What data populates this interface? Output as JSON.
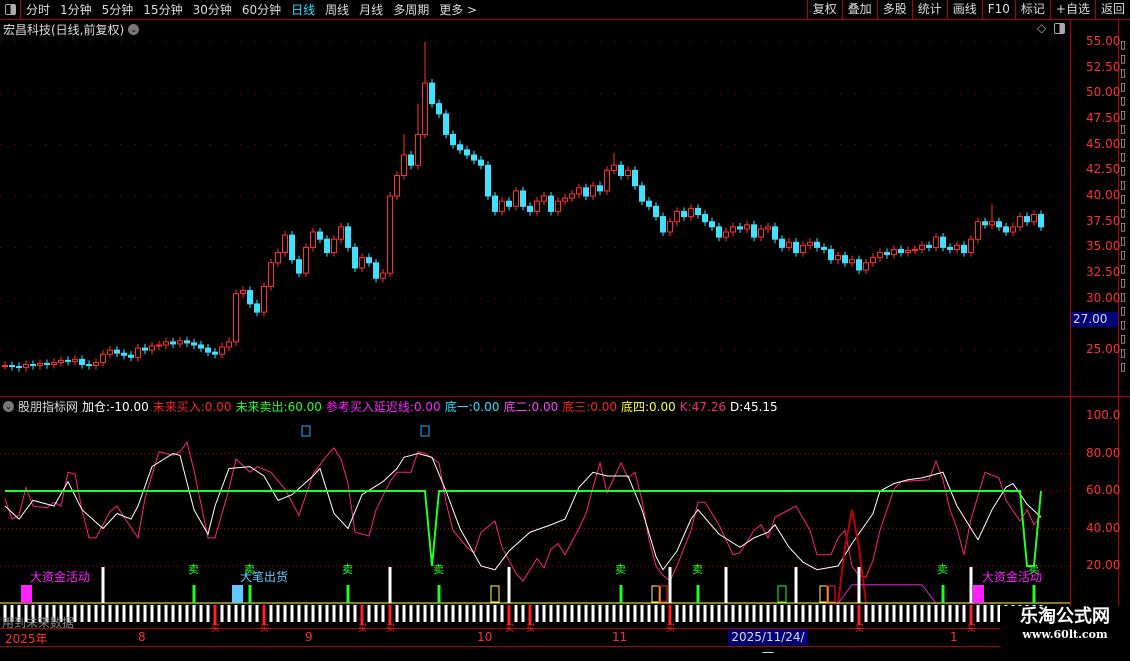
{
  "toolbar": {
    "periods": [
      "分时",
      "1分钟",
      "5分钟",
      "15分钟",
      "30分钟",
      "60分钟",
      "日线",
      "周线",
      "月线",
      "多周期",
      "更多 >"
    ],
    "active_period": "日线",
    "actions": [
      "复权",
      "叠加",
      "多股",
      "统计",
      "画线",
      "F10",
      "标记",
      "+自选",
      "返回"
    ]
  },
  "stock": {
    "title": "宏昌科技(日线,前复权)"
  },
  "price_axis": {
    "ticks": [
      "55.00",
      "52.50",
      "50.00",
      "47.50",
      "45.00",
      "42.50",
      "40.00",
      "37.50",
      "35.00",
      "32.50",
      "30.00",
      "25.00"
    ],
    "cursor_price": "27.00"
  },
  "indicator": {
    "name": "股朋指标网",
    "items": [
      {
        "label": "加仓:",
        "value": "-10.00",
        "color": "#ffffff"
      },
      {
        "label": "未来买入:",
        "value": "0.00",
        "color": "#ff2020"
      },
      {
        "label": "未来卖出:",
        "value": "60.00",
        "color": "#20ff20"
      },
      {
        "label": "参考买入延迟线:",
        "value": "0.00",
        "color": "#ff20ff"
      },
      {
        "label": "底一:",
        "value": "0.00",
        "color": "#20e0ff"
      },
      {
        "label": "底二:",
        "value": "0.00",
        "color": "#ff40ff"
      },
      {
        "label": "底三:",
        "value": "0.00",
        "color": "#ff2020"
      },
      {
        "label": "底四:",
        "value": "0.00",
        "color": "#ffff20"
      },
      {
        "label": "K:",
        "value": "47.26",
        "color": "#ff2080"
      },
      {
        "label": "D:",
        "value": "45.15",
        "color": "#ffffff"
      }
    ],
    "ticks": [
      "100.0",
      "80.00",
      "60.00",
      "40.00",
      "20.00"
    ],
    "signals": {
      "big_money": "大资金活动",
      "big_sell": "大笔出货",
      "sell": "卖",
      "buy": "买"
    },
    "future_note": "用到未来数据"
  },
  "date_axis": {
    "labels": [
      "2025年",
      "8",
      "9",
      "10",
      "11",
      "1"
    ],
    "cursor_date": "2025/11/24/一"
  },
  "watermark": {
    "name": "乐淘公式网",
    "url": "www.60lt.com"
  },
  "colors": {
    "up": "#ff3030",
    "down": "#40e0ff",
    "grid": "#b00000"
  },
  "chart_data": {
    "type": "candlestick",
    "price_range": [
      22,
      56
    ],
    "closes": [
      23.5,
      23.4,
      23.3,
      23.6,
      23.5,
      23.7,
      23.6,
      23.8,
      24.0,
      23.9,
      24.1,
      23.6,
      23.5,
      23.8,
      24.6,
      25.0,
      24.7,
      24.5,
      24.3,
      25.2,
      25.0,
      25.4,
      25.5,
      25.8,
      25.6,
      25.9,
      25.7,
      25.5,
      25.2,
      24.8,
      24.6,
      25.3,
      25.8,
      30.5,
      30.8,
      29.5,
      28.7,
      31.2,
      33.5,
      34.5,
      36.2,
      33.8,
      32.5,
      35.0,
      36.5,
      35.8,
      34.5,
      35.8,
      37.0,
      35.0,
      33.0,
      34.0,
      33.5,
      32.0,
      32.5,
      40.0,
      42.0,
      44.0,
      43.0,
      46.0,
      51.0,
      49.0,
      48.0,
      46.0,
      45.0,
      44.5,
      44.0,
      43.5,
      43.0,
      40.0,
      38.5,
      39.5,
      39.0,
      40.5,
      39.0,
      38.5,
      39.5,
      40.0,
      38.5,
      39.5,
      39.8,
      40.2,
      40.8,
      40.0,
      41.0,
      40.5,
      42.5,
      43.0,
      42.0,
      42.5,
      41.0,
      39.5,
      39.0,
      38.0,
      36.5,
      37.5,
      38.5,
      38.0,
      38.8,
      38.2,
      37.5,
      37.0,
      36.0,
      36.5,
      37.0,
      36.8,
      37.2,
      36.0,
      36.8,
      37.0,
      35.8,
      35.0,
      35.5,
      34.5,
      35.2,
      35.5,
      35.0,
      34.8,
      33.8,
      34.2,
      33.5,
      33.8,
      32.8,
      33.5,
      34.0,
      34.5,
      34.3,
      34.8,
      34.5,
      34.7,
      34.8,
      35.2,
      35.0,
      36.0,
      35.0,
      34.8,
      35.2,
      34.5,
      35.8,
      37.5,
      37.2,
      37.5,
      37.0,
      36.5,
      37.0,
      38.0,
      37.5,
      38.2,
      37.0
    ],
    "high_overrides": {
      "60": 55.0,
      "59": 49.0,
      "57": 46.0,
      "87": 44.2,
      "141": 39.2
    },
    "indicator_range": [
      0,
      100
    ],
    "k": [
      [
        0,
        56
      ],
      [
        1,
        45
      ],
      [
        2,
        47
      ],
      [
        3,
        62
      ],
      [
        4,
        52
      ],
      [
        6,
        51
      ],
      [
        7,
        54
      ],
      [
        8,
        52
      ],
      [
        9,
        70
      ],
      [
        10,
        69
      ],
      [
        11,
        50
      ],
      [
        12,
        35
      ],
      [
        13,
        35
      ],
      [
        15,
        49
      ],
      [
        16,
        52
      ],
      [
        17,
        46
      ],
      [
        19,
        35
      ],
      [
        20,
        56
      ],
      [
        22,
        81
      ],
      [
        24,
        79
      ],
      [
        25,
        81
      ],
      [
        26,
        86
      ],
      [
        27,
        71
      ],
      [
        29,
        35
      ],
      [
        30,
        35
      ],
      [
        32,
        61
      ],
      [
        33,
        77
      ],
      [
        35,
        70
      ],
      [
        36,
        73
      ],
      [
        38,
        70
      ],
      [
        40,
        61
      ],
      [
        42,
        47
      ],
      [
        44,
        69
      ],
      [
        46,
        79
      ],
      [
        47,
        83
      ],
      [
        48,
        77
      ],
      [
        49,
        64
      ],
      [
        50,
        38
      ],
      [
        52,
        36
      ],
      [
        53,
        50
      ],
      [
        55,
        65
      ],
      [
        56,
        70
      ],
      [
        58,
        70
      ],
      [
        59,
        81
      ],
      [
        60,
        80
      ],
      [
        62,
        75
      ],
      [
        63,
        54
      ],
      [
        64,
        39
      ],
      [
        66,
        30
      ],
      [
        67,
        27
      ],
      [
        68,
        38
      ],
      [
        70,
        44
      ],
      [
        71,
        30
      ],
      [
        73,
        16
      ],
      [
        74,
        12
      ],
      [
        76,
        24
      ],
      [
        77,
        19
      ],
      [
        78,
        29
      ],
      [
        79,
        32
      ],
      [
        80,
        26
      ],
      [
        82,
        40
      ],
      [
        83,
        48
      ],
      [
        84,
        62
      ],
      [
        85,
        75
      ],
      [
        86,
        59
      ],
      [
        88,
        75
      ],
      [
        89,
        67
      ],
      [
        90,
        70
      ],
      [
        91,
        55
      ],
      [
        92,
        34
      ],
      [
        93,
        20
      ],
      [
        94,
        15
      ],
      [
        95,
        12
      ],
      [
        96,
        20
      ],
      [
        98,
        39
      ],
      [
        99,
        54
      ],
      [
        100,
        54
      ],
      [
        102,
        42
      ],
      [
        104,
        26
      ],
      [
        105,
        27
      ],
      [
        107,
        39
      ],
      [
        108,
        42
      ],
      [
        109,
        35
      ],
      [
        110,
        46
      ],
      [
        112,
        50
      ],
      [
        113,
        52
      ],
      [
        115,
        39
      ],
      [
        116,
        26
      ],
      [
        118,
        26
      ],
      [
        119,
        35
      ],
      [
        120,
        39
      ],
      [
        121,
        20
      ],
      [
        122,
        15
      ],
      [
        123,
        14
      ],
      [
        124,
        23
      ],
      [
        125,
        39
      ],
      [
        126,
        50
      ],
      [
        127,
        61
      ],
      [
        128,
        65
      ],
      [
        132,
        66
      ],
      [
        133,
        76
      ],
      [
        134,
        66
      ],
      [
        135,
        50
      ],
      [
        136,
        40
      ],
      [
        137,
        26
      ],
      [
        138,
        45
      ],
      [
        140,
        70
      ],
      [
        142,
        67
      ],
      [
        143,
        55
      ],
      [
        145,
        44
      ],
      [
        146,
        50
      ],
      [
        147,
        42
      ],
      [
        148,
        47
      ]
    ],
    "d": [
      [
        0,
        52
      ],
      [
        2,
        45
      ],
      [
        4,
        55
      ],
      [
        7,
        52
      ],
      [
        9,
        65
      ],
      [
        11,
        50
      ],
      [
        14,
        40
      ],
      [
        16,
        48
      ],
      [
        18,
        45
      ],
      [
        19,
        52
      ],
      [
        21,
        73
      ],
      [
        24,
        80
      ],
      [
        25,
        79
      ],
      [
        27,
        50
      ],
      [
        29,
        37
      ],
      [
        30,
        52
      ],
      [
        32,
        72
      ],
      [
        35,
        73
      ],
      [
        37,
        68
      ],
      [
        39,
        55
      ],
      [
        41,
        58
      ],
      [
        44,
        68
      ],
      [
        45,
        72
      ],
      [
        47,
        48
      ],
      [
        49,
        40
      ],
      [
        51,
        58
      ],
      [
        54,
        65
      ],
      [
        56,
        72
      ],
      [
        57,
        78
      ],
      [
        59,
        80
      ],
      [
        61,
        78
      ],
      [
        63,
        60
      ],
      [
        65,
        40
      ],
      [
        68,
        20
      ],
      [
        70,
        18
      ],
      [
        72,
        28
      ],
      [
        75,
        38
      ],
      [
        78,
        42
      ],
      [
        80,
        45
      ],
      [
        82,
        62
      ],
      [
        84,
        70
      ],
      [
        86,
        68
      ],
      [
        89,
        68
      ],
      [
        91,
        50
      ],
      [
        93,
        25
      ],
      [
        94,
        18
      ],
      [
        96,
        28
      ],
      [
        98,
        45
      ],
      [
        99,
        50
      ],
      [
        102,
        37
      ],
      [
        105,
        30
      ],
      [
        107,
        35
      ],
      [
        109,
        38
      ],
      [
        110,
        42
      ],
      [
        112,
        30
      ],
      [
        114,
        22
      ],
      [
        116,
        18
      ],
      [
        119,
        20
      ],
      [
        121,
        32
      ],
      [
        124,
        48
      ],
      [
        125,
        60
      ],
      [
        127,
        64
      ],
      [
        129,
        66
      ],
      [
        131,
        67
      ],
      [
        134,
        70
      ],
      [
        136,
        52
      ],
      [
        138,
        40
      ],
      [
        139,
        34
      ],
      [
        141,
        50
      ],
      [
        143,
        62
      ],
      [
        144,
        64
      ],
      [
        146,
        53
      ],
      [
        148,
        46
      ]
    ],
    "future_sell": [
      [
        0,
        60
      ],
      [
        60,
        60
      ],
      [
        61,
        20
      ],
      [
        62,
        60
      ],
      [
        145,
        60
      ],
      [
        146,
        20
      ],
      [
        147,
        20
      ],
      [
        148,
        60
      ]
    ],
    "buy_bars": [
      30,
      37,
      51,
      55,
      72,
      75,
      95,
      122,
      138
    ],
    "sell_bars": [
      27,
      35,
      49,
      62,
      88,
      99,
      134,
      147
    ],
    "tall_bars": [
      14,
      55,
      72,
      95,
      103,
      113,
      122,
      138
    ],
    "big_money_bars": [
      3,
      139
    ],
    "big_sell_bars": [
      33
    ],
    "marker_bars": [
      43,
      60
    ]
  }
}
